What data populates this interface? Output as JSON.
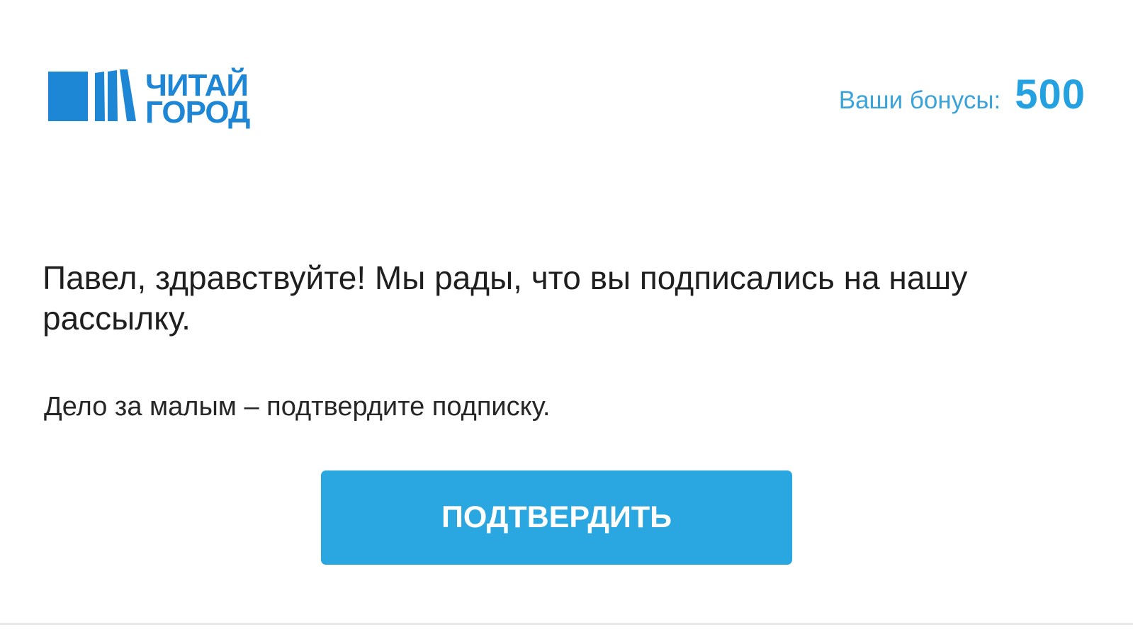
{
  "header": {
    "logo": {
      "line1": "ЧИТАЙ",
      "line2": "ГОРОД",
      "icon": "books-icon",
      "color": "#1d87d6"
    },
    "bonus": {
      "label": "Ваши бонусы:",
      "value": "500"
    }
  },
  "main": {
    "greeting": "Павел, здравствуйте! Мы рады, что вы подписались на нашу рассылку.",
    "subtext": "Дело за малым – подтвердите подписку.",
    "confirm_label": "ПОДТВЕРДИТЬ"
  },
  "colors": {
    "accent": "#2aa7e1",
    "bonus_text": "#3ca2da",
    "text": "#1f1f1f"
  }
}
